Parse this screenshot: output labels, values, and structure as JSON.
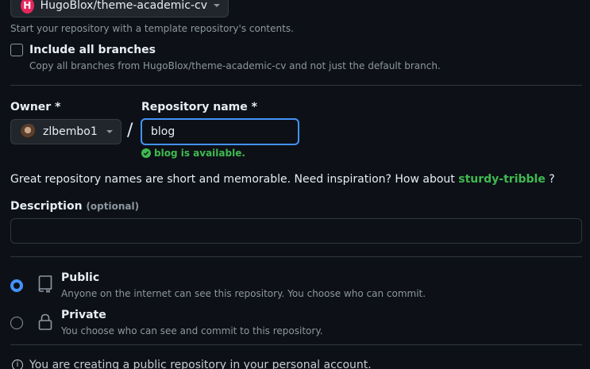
{
  "template": {
    "selected": "HugoBlox/theme-academic-cv",
    "help": "Start your repository with a template repository's contents."
  },
  "include_branches": {
    "label": "Include all branches",
    "help": "Copy all branches from HugoBlox/theme-academic-cv and not just the default branch.",
    "checked": false
  },
  "owner": {
    "label": "Owner *",
    "value": "zlbembo1"
  },
  "separator": "/",
  "repository": {
    "label": "Repository name *",
    "value": "blog",
    "availability": "blog is available."
  },
  "suggestion": {
    "prefix": "Great repository names are short and memorable. Need inspiration? How about",
    "name": "sturdy-tribble",
    "suffix": "?"
  },
  "description": {
    "label": "Description",
    "optional": "(optional)",
    "value": ""
  },
  "visibility": {
    "options": [
      {
        "label": "Public",
        "help": "Anyone on the internet can see this repository. You choose who can commit.",
        "selected": true,
        "icon": "repo-icon"
      },
      {
        "label": "Private",
        "help": "You choose who can see and commit to this repository.",
        "selected": false,
        "icon": "lock-icon"
      }
    ]
  },
  "info": {
    "text": "You are creating a public repository in your personal account."
  },
  "colors": {
    "accent": "#4493f8",
    "success": "#3fb950",
    "background": "#0d1117"
  }
}
